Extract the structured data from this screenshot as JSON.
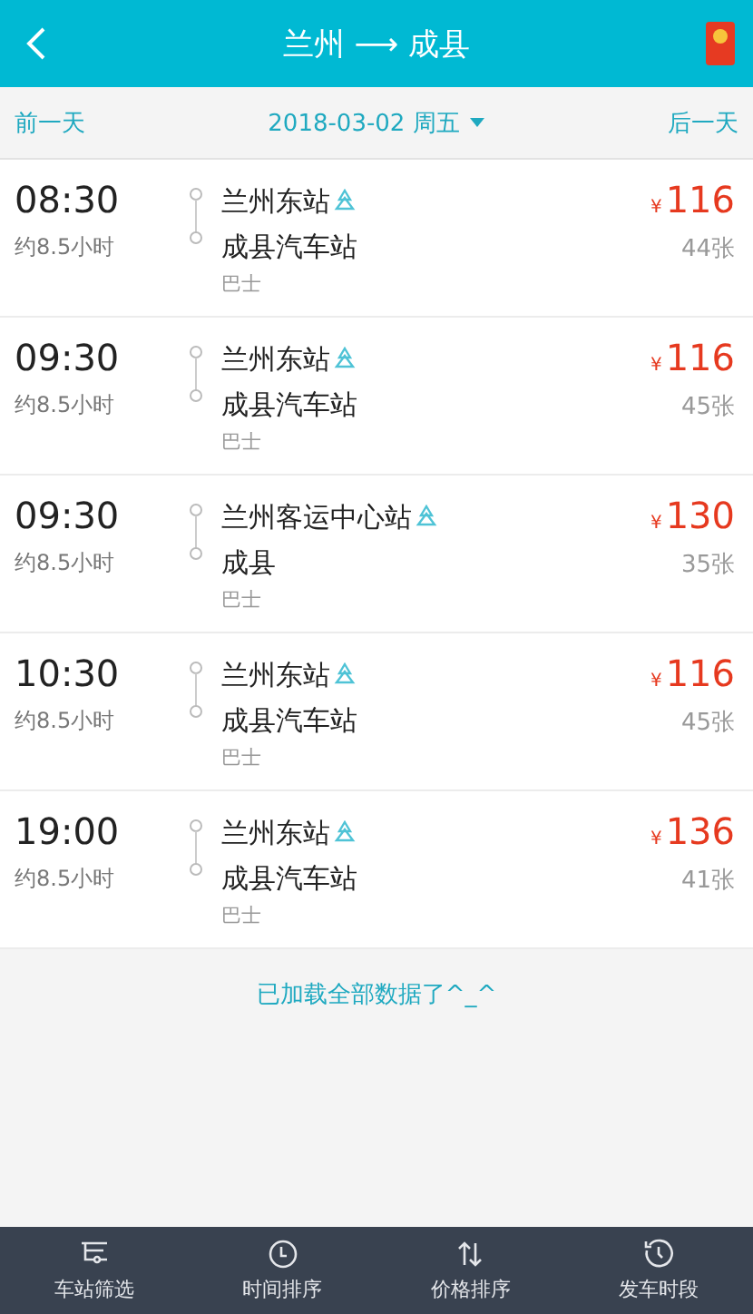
{
  "header": {
    "title": "兰州 ⟶ 成县"
  },
  "date_bar": {
    "prev": "前一天",
    "date": "2018-03-02 周五",
    "next": "后一天"
  },
  "trips": [
    {
      "time": "08:30",
      "duration": "约8.5小时",
      "from": "兰州东站",
      "to": "成县汽车站",
      "vehicle": "巴士",
      "currency": "¥",
      "price": "116",
      "seats": "44张"
    },
    {
      "time": "09:30",
      "duration": "约8.5小时",
      "from": "兰州东站",
      "to": "成县汽车站",
      "vehicle": "巴士",
      "currency": "¥",
      "price": "116",
      "seats": "45张"
    },
    {
      "time": "09:30",
      "duration": "约8.5小时",
      "from": "兰州客运中心站",
      "to": "成县",
      "vehicle": "巴士",
      "currency": "¥",
      "price": "130",
      "seats": "35张"
    },
    {
      "time": "10:30",
      "duration": "约8.5小时",
      "from": "兰州东站",
      "to": "成县汽车站",
      "vehicle": "巴士",
      "currency": "¥",
      "price": "116",
      "seats": "45张"
    },
    {
      "time": "19:00",
      "duration": "约8.5小时",
      "from": "兰州东站",
      "to": "成县汽车站",
      "vehicle": "巴士",
      "currency": "¥",
      "price": "136",
      "seats": "41张"
    }
  ],
  "footer_note": "已加载全部数据了^_^",
  "tab_bar": [
    {
      "kind": "filter",
      "label": "车站筛选"
    },
    {
      "kind": "time",
      "label": "时间排序"
    },
    {
      "kind": "price",
      "label": "价格排序"
    },
    {
      "kind": "period",
      "label": "发车时段"
    }
  ]
}
